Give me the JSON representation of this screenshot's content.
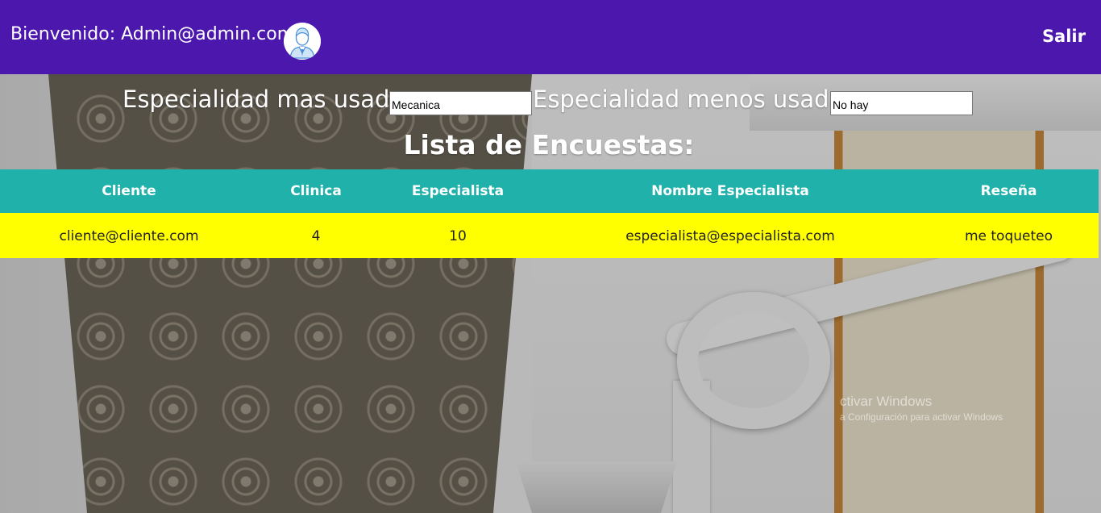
{
  "header": {
    "welcome_text": "Bienvenido: Admin@admin.com",
    "avatar_icon": "user-avatar-icon",
    "logout_label": "Salir",
    "background_color": "#4c17ad"
  },
  "stats": {
    "most_used_label": "Especialidad mas usada",
    "most_used_value": "Mecanica",
    "least_used_label": "Especialidad menos usada",
    "least_used_value": "No hay"
  },
  "surveys": {
    "title": "Lista de Encuestas:",
    "columns": [
      "Cliente",
      "Clinica",
      "Especialista",
      "Nombre Especialista",
      "Reseña"
    ],
    "rows": [
      [
        "cliente@cliente.com",
        "4",
        "10",
        "especialista@especialista.com",
        "me toqueteo"
      ]
    ],
    "header_color": "#20b2aa",
    "row_color": "#ffff00"
  },
  "watermark": {
    "line1": "ctivar Windows",
    "line2": "a Configuración para activar Windows"
  }
}
